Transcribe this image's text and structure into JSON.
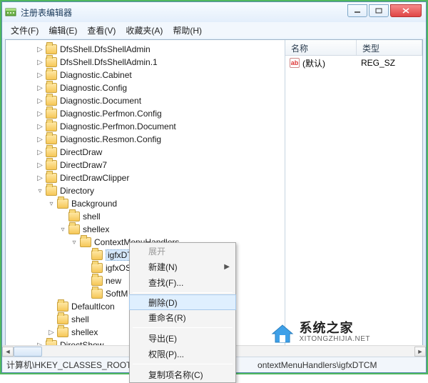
{
  "window": {
    "title": "注册表编辑器"
  },
  "menu": {
    "file": "文件(F)",
    "edit": "编辑(E)",
    "view": "查看(V)",
    "fav": "收藏夹(A)",
    "help": "帮助(H)"
  },
  "tree": {
    "items": [
      {
        "depth": 2,
        "exp": "▷",
        "label": "DfsShell.DfsShellAdmin"
      },
      {
        "depth": 2,
        "exp": "▷",
        "label": "DfsShell.DfsShellAdmin.1"
      },
      {
        "depth": 2,
        "exp": "▷",
        "label": "Diagnostic.Cabinet"
      },
      {
        "depth": 2,
        "exp": "▷",
        "label": "Diagnostic.Config"
      },
      {
        "depth": 2,
        "exp": "▷",
        "label": "Diagnostic.Document"
      },
      {
        "depth": 2,
        "exp": "▷",
        "label": "Diagnostic.Perfmon.Config"
      },
      {
        "depth": 2,
        "exp": "▷",
        "label": "Diagnostic.Perfmon.Document"
      },
      {
        "depth": 2,
        "exp": "▷",
        "label": "Diagnostic.Resmon.Config"
      },
      {
        "depth": 2,
        "exp": "▷",
        "label": "DirectDraw"
      },
      {
        "depth": 2,
        "exp": "▷",
        "label": "DirectDraw7"
      },
      {
        "depth": 2,
        "exp": "▷",
        "label": "DirectDrawClipper"
      },
      {
        "depth": 2,
        "exp": "▿",
        "label": "Directory"
      },
      {
        "depth": 3,
        "exp": "▿",
        "label": "Background"
      },
      {
        "depth": 4,
        "exp": "",
        "label": "shell"
      },
      {
        "depth": 4,
        "exp": "▿",
        "label": "shellex"
      },
      {
        "depth": 5,
        "exp": "▿",
        "label": "ContextMenuHandlers"
      },
      {
        "depth": 6,
        "exp": "",
        "label": "igfxDTCM",
        "selected": true
      },
      {
        "depth": 6,
        "exp": "",
        "label": "igfxOS"
      },
      {
        "depth": 6,
        "exp": "",
        "label": "new"
      },
      {
        "depth": 6,
        "exp": "",
        "label": "SoftM"
      },
      {
        "depth": 3,
        "exp": "",
        "label": "DefaultIcon"
      },
      {
        "depth": 3,
        "exp": "",
        "label": "shell"
      },
      {
        "depth": 3,
        "exp": "▷",
        "label": "shellex"
      },
      {
        "depth": 2,
        "exp": "▷",
        "label": "DirectShow"
      }
    ]
  },
  "list": {
    "col_name": "名称",
    "col_type": "类型",
    "default_label": "(默认)",
    "default_type": "REG_SZ"
  },
  "context_menu": {
    "expand": "展开",
    "new": "新建(N)",
    "find": "查找(F)...",
    "delete": "删除(D)",
    "rename": "重命名(R)",
    "export": "导出(E)",
    "perm": "权限(P)...",
    "copyname": "复制项名称(C)"
  },
  "statusbar": {
    "path": "计算机\\HKEY_CLASSES_ROOT\\Dir",
    "path2": "ontextMenuHandlers\\igfxDTCM"
  },
  "watermark": {
    "cn": "系统之家",
    "en": "XITONGZHIJIA.NET"
  }
}
